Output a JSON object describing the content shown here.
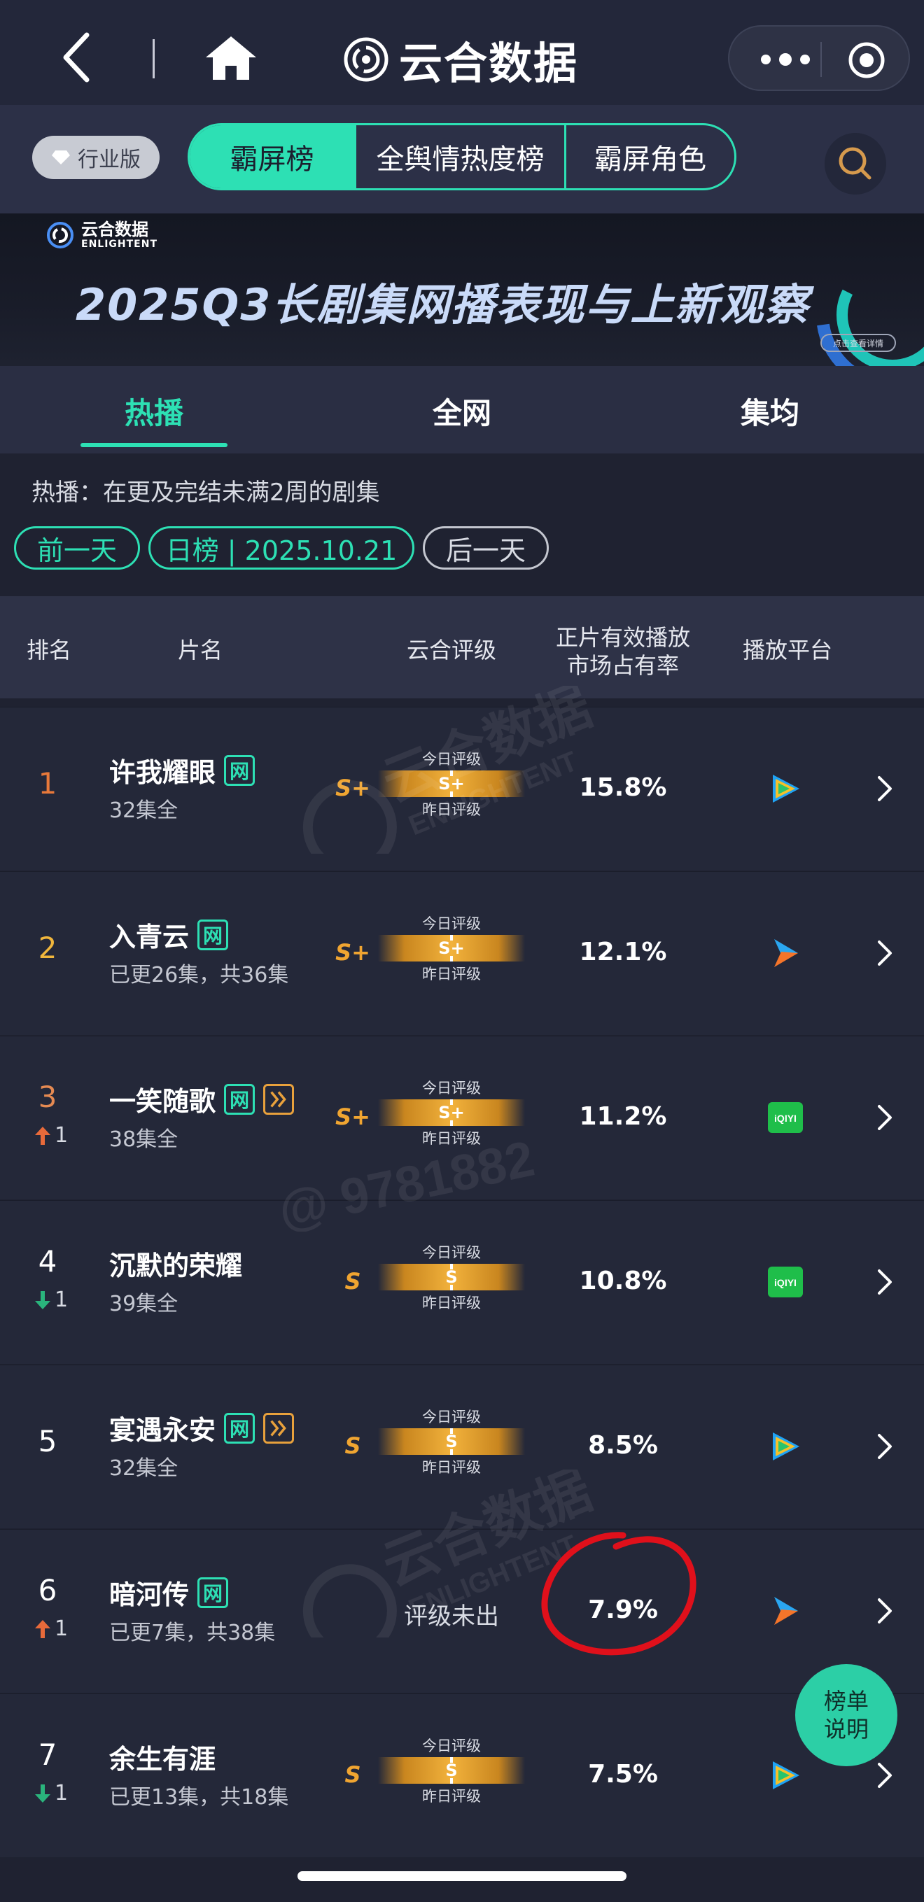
{
  "app": {
    "title": "云合数据",
    "nav_icons": [
      "back-icon",
      "home-icon",
      "more-dots-icon",
      "target-icon"
    ]
  },
  "subheader": {
    "edition": "行业版",
    "segments": [
      "霸屏榜",
      "全舆情热度榜",
      "霸屏角色"
    ],
    "active_segment": "霸屏榜"
  },
  "banner": {
    "brand_cn": "云合数据",
    "brand_en": "ENLIGHTENT",
    "headline": "2025Q3长剧集网播表现与上新观察",
    "detail_button": "点击查看详情"
  },
  "tabs": [
    "热播",
    "全网",
    "集均"
  ],
  "active_tab": "热播",
  "hint": "热播：在更及完结未满2周的剧集",
  "date_nav": {
    "prev": "前一天",
    "current": "日榜 | 2025.10.21",
    "next": "后一天"
  },
  "table": {
    "headers": {
      "rank": "排名",
      "name": "片名",
      "grade": "云合评级",
      "share_line1": "正片有效播放",
      "share_line2": "市场占有率",
      "platform": "播放平台"
    },
    "today_label": "今日评级",
    "yesterday_label": "昨日评级",
    "rows": [
      {
        "rank": "1",
        "move": "",
        "title": "许我耀眼",
        "sub": "32集全",
        "badge_wang": "网",
        "badge_play": false,
        "grade": "S+",
        "bar": "S+",
        "share": "15.8%",
        "platform": "tencent-video"
      },
      {
        "rank": "2",
        "move": "",
        "title": "入青云",
        "sub": "已更26集，共36集",
        "badge_wang": "网",
        "badge_play": false,
        "grade": "S+",
        "bar": "S+",
        "share": "12.1%",
        "platform": "youku"
      },
      {
        "rank": "3",
        "move": "1",
        "move_dir": "up",
        "title": "一笑随歌",
        "sub": "38集全",
        "badge_wang": "网",
        "badge_play": true,
        "grade": "S+",
        "bar": "S+",
        "share": "11.2%",
        "platform": "iqiyi"
      },
      {
        "rank": "4",
        "move": "1",
        "move_dir": "down",
        "title": "沉默的荣耀",
        "sub": "39集全",
        "badge_wang": "",
        "badge_play": false,
        "grade": "S",
        "bar": "S",
        "share": "10.8%",
        "platform": "iqiyi"
      },
      {
        "rank": "5",
        "move": "",
        "title": "宴遇永安",
        "sub": "32集全",
        "badge_wang": "网",
        "badge_play": true,
        "grade": "S",
        "bar": "S",
        "share": "8.5%",
        "platform": "tencent-video"
      },
      {
        "rank": "6",
        "move": "1",
        "move_dir": "up",
        "title": "暗河传",
        "sub": "已更7集，共38集",
        "badge_wang": "网",
        "badge_play": false,
        "grade": "",
        "bar": "",
        "pending": "评级未出",
        "share": "7.9%",
        "platform": "youku"
      },
      {
        "rank": "7",
        "move": "1",
        "move_dir": "down",
        "title": "余生有涯",
        "sub": "已更13集，共18集",
        "badge_wang": "",
        "badge_play": false,
        "grade": "S",
        "bar": "S",
        "share": "7.5%",
        "platform": "tencent-video"
      }
    ]
  },
  "platform_text": {
    "iqiyi": "iQIYI"
  },
  "fab": {
    "line1": "榜单",
    "line2": "说明"
  },
  "watermark": {
    "brand_cn": "云合数据",
    "brand_en": "ENLIGHTENT",
    "user": "@ 9781882"
  },
  "colors": {
    "accent": "#2de0b4",
    "grade": "#f0a531",
    "rank1": "#e8793a",
    "rank2": "#f0b63c",
    "rank3": "#e58a52",
    "up": "#e86a3a",
    "down": "#2ab47c",
    "annotation": "#e0101b"
  }
}
